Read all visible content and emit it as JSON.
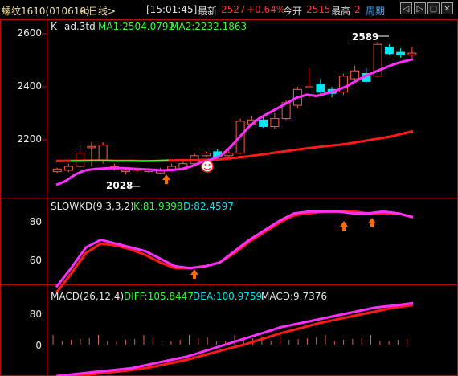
{
  "header": {
    "title": "螺纹1610(010610)",
    "period": "<日线>",
    "time": "[15:01:45]",
    "latest_label": "最新",
    "latest_value": "2527",
    "change": "+0.64%",
    "open_label": "今开",
    "open_value": "2515",
    "high_label": "最高",
    "high_value": "2",
    "period_tab": "周期"
  },
  "panels": {
    "main": {
      "label_k": "K",
      "label_name": "ad.3td",
      "ma1": "MA1:2504.0792",
      "ma2": "MA2:2232.1863",
      "y_ticks": [
        "2600",
        "2400",
        "2200"
      ],
      "annotation_high": "2589",
      "annotation_low": "2028"
    },
    "kd": {
      "name": "SLOWKD(9,3,3,2)",
      "k": "K:81.9398",
      "d": "D:82.4597",
      "y_ticks": [
        "80",
        "60"
      ]
    },
    "macd": {
      "name": "MACD(26,12,4)",
      "diff": "DIFF:105.8447",
      "dea": "DEA:100.9759",
      "macd": "MACD:9.7376",
      "y_ticks": [
        "80",
        "0"
      ]
    }
  },
  "colors": {
    "grid_border": "#b01010",
    "up": "#ff5a3c",
    "down": "#00e6f0",
    "ma1": "#ff30ff",
    "ma2": "#ff1a1a",
    "ma_green": "#30ff30",
    "accent_red": "#ff3030",
    "title_gold": "#f0e0a0"
  },
  "chart_data": {
    "type": "line",
    "price_series": {
      "ma1": [
        2030,
        2045,
        2070,
        2085,
        2090,
        2092,
        2094,
        2093,
        2091,
        2089,
        2087,
        2085,
        2086,
        2090,
        2100,
        2115,
        2125,
        2138,
        2170,
        2210,
        2250,
        2280,
        2300,
        2320,
        2340,
        2360,
        2370,
        2365,
        2375,
        2385,
        2400,
        2420,
        2440,
        2455,
        2470,
        2485,
        2495,
        2504
      ],
      "ma2": [
        2120,
        2121,
        2121,
        2122,
        2122,
        2122,
        2121,
        2121,
        2121,
        2120,
        2120,
        2121,
        2122,
        2123,
        2123,
        2124,
        2125,
        2126,
        2130,
        2134,
        2138,
        2143,
        2148,
        2153,
        2158,
        2163,
        2168,
        2172,
        2176,
        2180,
        2184,
        2190,
        2196,
        2202,
        2208,
        2215,
        2224,
        2232
      ],
      "ohlc": [
        [
          2080,
          2090,
          2075,
          2095
        ],
        [
          2085,
          2100,
          2078,
          2110
        ],
        [
          2100,
          2150,
          2095,
          2180
        ],
        [
          2170,
          2175,
          2100,
          2190
        ],
        [
          2120,
          2180,
          2110,
          2190
        ],
        [
          2090,
          2100,
          2085,
          2110
        ],
        [
          2080,
          2085,
          2070,
          2095
        ],
        [
          2085,
          2090,
          2078,
          2095
        ],
        [
          2080,
          2088,
          2075,
          2095
        ],
        [
          2075,
          2085,
          2070,
          2095
        ],
        [
          2090,
          2100,
          2085,
          2110
        ],
        [
          2090,
          2110,
          2085,
          2120
        ],
        [
          2110,
          2140,
          2105,
          2150
        ],
        [
          2140,
          2150,
          2135,
          2155
        ],
        [
          2155,
          2135,
          2130,
          2165
        ],
        [
          2140,
          2150,
          2135,
          2160
        ],
        [
          2150,
          2270,
          2145,
          2280
        ],
        [
          2260,
          2275,
          2250,
          2290
        ],
        [
          2275,
          2250,
          2245,
          2290
        ],
        [
          2250,
          2280,
          2240,
          2300
        ],
        [
          2280,
          2340,
          2275,
          2350
        ],
        [
          2330,
          2390,
          2320,
          2400
        ],
        [
          2370,
          2400,
          2360,
          2470
        ],
        [
          2410,
          2380,
          2370,
          2430
        ],
        [
          2390,
          2375,
          2360,
          2400
        ],
        [
          2380,
          2440,
          2370,
          2450
        ],
        [
          2430,
          2460,
          2420,
          2480
        ],
        [
          2450,
          2420,
          2415,
          2470
        ],
        [
          2440,
          2560,
          2435,
          2570
        ],
        [
          2550,
          2525,
          2520,
          2560
        ],
        [
          2530,
          2520,
          2510,
          2545
        ],
        [
          2520,
          2527,
          2510,
          2550
        ]
      ]
    },
    "kd_series": {
      "k": [
        45,
        55,
        66,
        70,
        68,
        66,
        64,
        60,
        56,
        55,
        56,
        58,
        64,
        70,
        75,
        80,
        84,
        85,
        85,
        85,
        84,
        84,
        85,
        84,
        82
      ],
      "d": [
        42,
        52,
        63,
        68,
        67,
        65,
        62,
        58,
        55,
        55,
        56,
        58,
        63,
        69,
        74,
        79,
        83,
        84,
        85,
        85,
        85,
        84,
        84,
        84,
        82
      ]
    },
    "macd_series": {
      "diff": [
        -80,
        -75,
        -70,
        -65,
        -60,
        -50,
        -40,
        -30,
        -15,
        0,
        15,
        30,
        45,
        55,
        65,
        75,
        85,
        95,
        100,
        106
      ],
      "dea": [
        -82,
        -80,
        -75,
        -70,
        -65,
        -58,
        -48,
        -38,
        -25,
        -12,
        0,
        15,
        30,
        42,
        55,
        65,
        75,
        85,
        95,
        101
      ]
    }
  }
}
